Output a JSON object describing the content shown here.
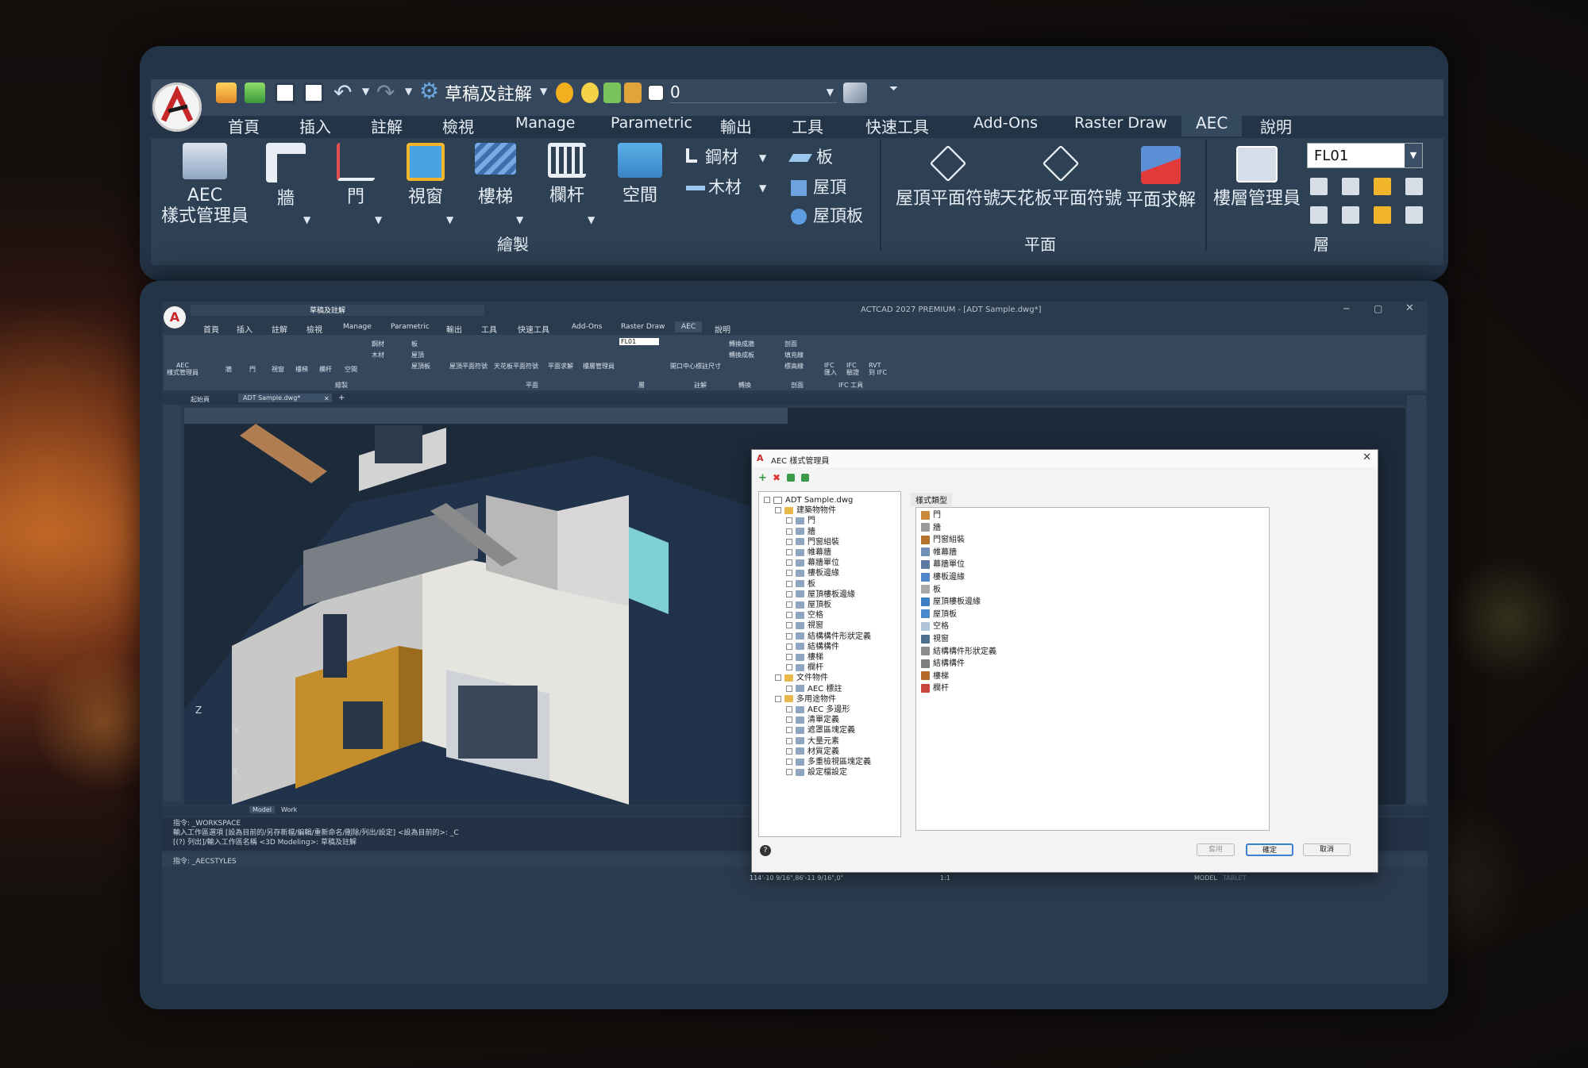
{
  "app": {
    "window_title": "ACTCAD 2027 PREMIUM - [ADT Sample.dwg*]",
    "logo_letter": "A",
    "workspace_name": "草稿及註解",
    "layer_name": "0",
    "accent": "#2f7cc0",
    "panel_bg": "#243447"
  },
  "zoom_ribbon": {
    "tabs": [
      {
        "label": "首頁"
      },
      {
        "label": "插入"
      },
      {
        "label": "註解"
      },
      {
        "label": "檢視"
      },
      {
        "label": "Manage"
      },
      {
        "label": "Parametric"
      },
      {
        "label": "輸出"
      },
      {
        "label": "工具"
      },
      {
        "label": "快速工具"
      },
      {
        "label": "Add-Ons"
      },
      {
        "label": "Raster Draw"
      },
      {
        "label": "AEC",
        "active": true
      },
      {
        "label": "說明"
      }
    ],
    "draw_group": {
      "title": "繪製",
      "aec_style_manager": "AEC\n樣式管理員",
      "aec_line1": "AEC",
      "aec_line2": "樣式管理員",
      "wall": "牆",
      "door": "門",
      "window": "視窗",
      "stair": "樓梯",
      "railing": "欄杆",
      "space": "空間",
      "steel": "鋼材",
      "timber": "木材",
      "slab": "板",
      "roof": "屋頂",
      "roof_slab": "屋頂板"
    },
    "plan_group": {
      "title": "平面",
      "roof_plan_symbol": "屋頂平面符號",
      "ceiling_plan_symbol": "天花板平面符號",
      "plan_solve": "平面求解"
    },
    "level_group": {
      "title": "層",
      "level_manager": "樓層管理員",
      "level_value": "FL01"
    }
  },
  "app_window": {
    "tabs": [
      {
        "label": "首頁"
      },
      {
        "label": "插入"
      },
      {
        "label": "註解"
      },
      {
        "label": "檢視"
      },
      {
        "label": "Manage"
      },
      {
        "label": "Parametric"
      },
      {
        "label": "輸出"
      },
      {
        "label": "工具"
      },
      {
        "label": "快速工具"
      },
      {
        "label": "Add-Ons"
      },
      {
        "label": "Raster Draw"
      },
      {
        "label": "AEC",
        "active": true
      },
      {
        "label": "說明"
      }
    ],
    "ribbon": {
      "aec_style_manager": "AEC\n樣式管理員",
      "wall": "牆",
      "door": "門",
      "window": "視窗",
      "stair": "樓梯",
      "railing": "欄杆",
      "space": "空間",
      "steel": "鋼材",
      "timber": "木材",
      "slab": "板",
      "roof": "屋頂",
      "roof_slab": "屋頂板",
      "draw_title": "繪製",
      "roof_plan_symbol": "屋頂平面符號",
      "ceiling_plan_symbol": "天花板平面符號",
      "plan_solve": "平面求解",
      "plan_title": "平面",
      "level_manager": "樓層管理員",
      "level_value": "FL01",
      "level_title": "層",
      "opening_dim": "開口中心標註尺寸",
      "annotate_title": "註解",
      "convert_to_1": "轉換成牆",
      "convert_to_2": "轉換成板",
      "convert_title": "轉換",
      "section": "剖面",
      "fill_line": "填充線",
      "hatch_line": "標高線",
      "section_title": "剖面",
      "ifc_import": "IFC\n匯入",
      "ifc_verify": "IFC\n驗證",
      "rvt_to_ifc": "RVT\n到 IFC",
      "ifc_title": "IFC 工具"
    },
    "doc_tabs": [
      {
        "label": "起始頁"
      },
      {
        "label": "ADT Sample.dwg*",
        "active": true
      }
    ],
    "layout_tabs": [
      {
        "label": "Model",
        "active": true
      },
      {
        "label": "Work"
      }
    ],
    "ucs": {
      "z": "Z",
      "y": "Y",
      "x": "X"
    },
    "command_history": [
      "指令: _WORKSPACE",
      "輸入工作區選項 [設為目前的/另存新檔/編輯/重新命名/刪除/列出/設定] <設為目前的>: _C",
      "[(?) 列出]/輸入工作區名稱 <3D Modeling>: 草稿及註解"
    ],
    "command_prompt": "指令: _AECSTYLES",
    "status": {
      "coordinates": "114'-10 9/16\",86'-11 9/16\",0\"",
      "scale": "1:1",
      "model": "MODEL",
      "tablet": "TABLET"
    }
  },
  "dialog": {
    "title": "AEC 樣式管理員",
    "right_header": "樣式類型",
    "tree": [
      {
        "label": "ADT Sample.dwg",
        "level": 0,
        "kind": "doc"
      },
      {
        "label": "建築物物件",
        "level": 1,
        "kind": "folder"
      },
      {
        "label": "門",
        "level": 2
      },
      {
        "label": "牆",
        "level": 2
      },
      {
        "label": "門窗組裝",
        "level": 2
      },
      {
        "label": "帷幕牆",
        "level": 2
      },
      {
        "label": "幕牆單位",
        "level": 2
      },
      {
        "label": "樓板邊緣",
        "level": 2
      },
      {
        "label": "板",
        "level": 2
      },
      {
        "label": "屋頂樓板邊緣",
        "level": 2
      },
      {
        "label": "屋頂板",
        "level": 2
      },
      {
        "label": "空格",
        "level": 2
      },
      {
        "label": "視窗",
        "level": 2
      },
      {
        "label": "結構構件形狀定義",
        "level": 2
      },
      {
        "label": "結構構件",
        "level": 2
      },
      {
        "label": "樓梯",
        "level": 2
      },
      {
        "label": "欄杆",
        "level": 2
      },
      {
        "label": "文件物件",
        "level": 1,
        "kind": "folder"
      },
      {
        "label": "AEC 標註",
        "level": 2
      },
      {
        "label": "多用途物件",
        "level": 1,
        "kind": "folder"
      },
      {
        "label": "AEC 多邊形",
        "level": 2
      },
      {
        "label": "清單定義",
        "level": 2
      },
      {
        "label": "遮罩區塊定義",
        "level": 2
      },
      {
        "label": "大量元素",
        "level": 2
      },
      {
        "label": "材質定義",
        "level": 2
      },
      {
        "label": "多重檢視區塊定義",
        "level": 2
      },
      {
        "label": "設定檔設定",
        "level": 2
      }
    ],
    "list": [
      {
        "label": "門",
        "color": "#c98a3b"
      },
      {
        "label": "牆",
        "color": "#9a9a9a"
      },
      {
        "label": "門窗組裝",
        "color": "#b5722c"
      },
      {
        "label": "帷幕牆",
        "color": "#6f8fb8"
      },
      {
        "label": "幕牆單位",
        "color": "#5c7aa3"
      },
      {
        "label": "樓板邊緣",
        "color": "#4f86c9"
      },
      {
        "label": "板",
        "color": "#a8a8a8"
      },
      {
        "label": "屋頂樓板邊緣",
        "color": "#3f7fc4"
      },
      {
        "label": "屋頂板",
        "color": "#4a88cc"
      },
      {
        "label": "空格",
        "color": "#b0c4d6"
      },
      {
        "label": "視窗",
        "color": "#4e6e8e"
      },
      {
        "label": "結構構件形狀定義",
        "color": "#8c8c8c"
      },
      {
        "label": "結構構件",
        "color": "#7d7d7d"
      },
      {
        "label": "樓梯",
        "color": "#b46a2a"
      },
      {
        "label": "欄杆",
        "color": "#c8463c"
      }
    ],
    "buttons": {
      "apply": "套用",
      "ok": "確定",
      "cancel": "取消"
    },
    "help": "?"
  }
}
